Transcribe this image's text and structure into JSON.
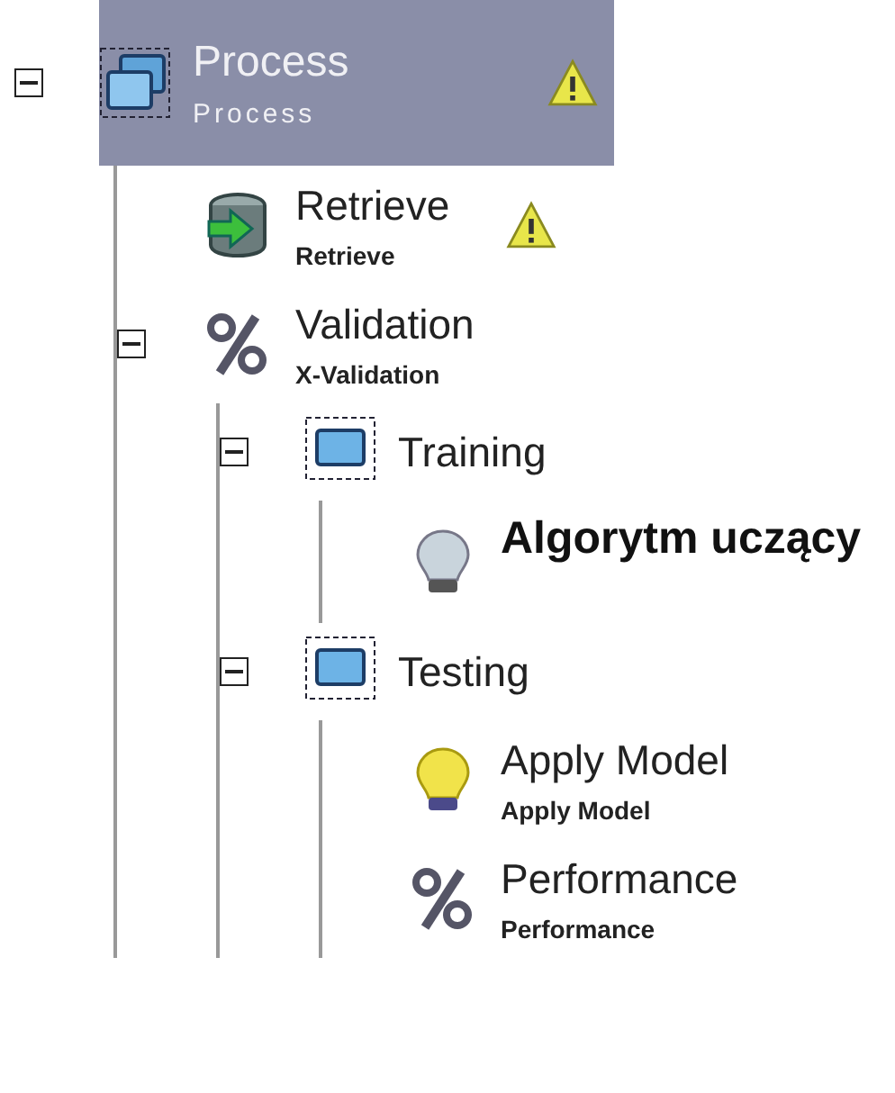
{
  "tree": [
    {
      "kind": "process",
      "title": "Process",
      "subtitle": "Process",
      "selected": true,
      "warning": true,
      "expanded": true,
      "children": [
        {
          "kind": "retrieve",
          "title": "Retrieve",
          "subtitle": "Retrieve",
          "selected": false,
          "warning": true
        },
        {
          "kind": "validation",
          "title": "Validation",
          "subtitle": "X-Validation",
          "selected": false,
          "expanded": true,
          "children": [
            {
              "kind": "subprocess",
              "title": "Training",
              "selected": false,
              "expanded": true,
              "children": [
                {
                  "kind": "learner",
                  "title": "Algorytm uczący",
                  "selected": false
                }
              ]
            },
            {
              "kind": "subprocess",
              "title": "Testing",
              "selected": false,
              "expanded": true,
              "children": [
                {
                  "kind": "apply",
                  "title": "Apply Model",
                  "subtitle": "Apply Model",
                  "selected": false
                },
                {
                  "kind": "performance",
                  "title": "Performance",
                  "subtitle": "Performance",
                  "selected": false
                }
              ]
            }
          ]
        }
      ]
    }
  ]
}
